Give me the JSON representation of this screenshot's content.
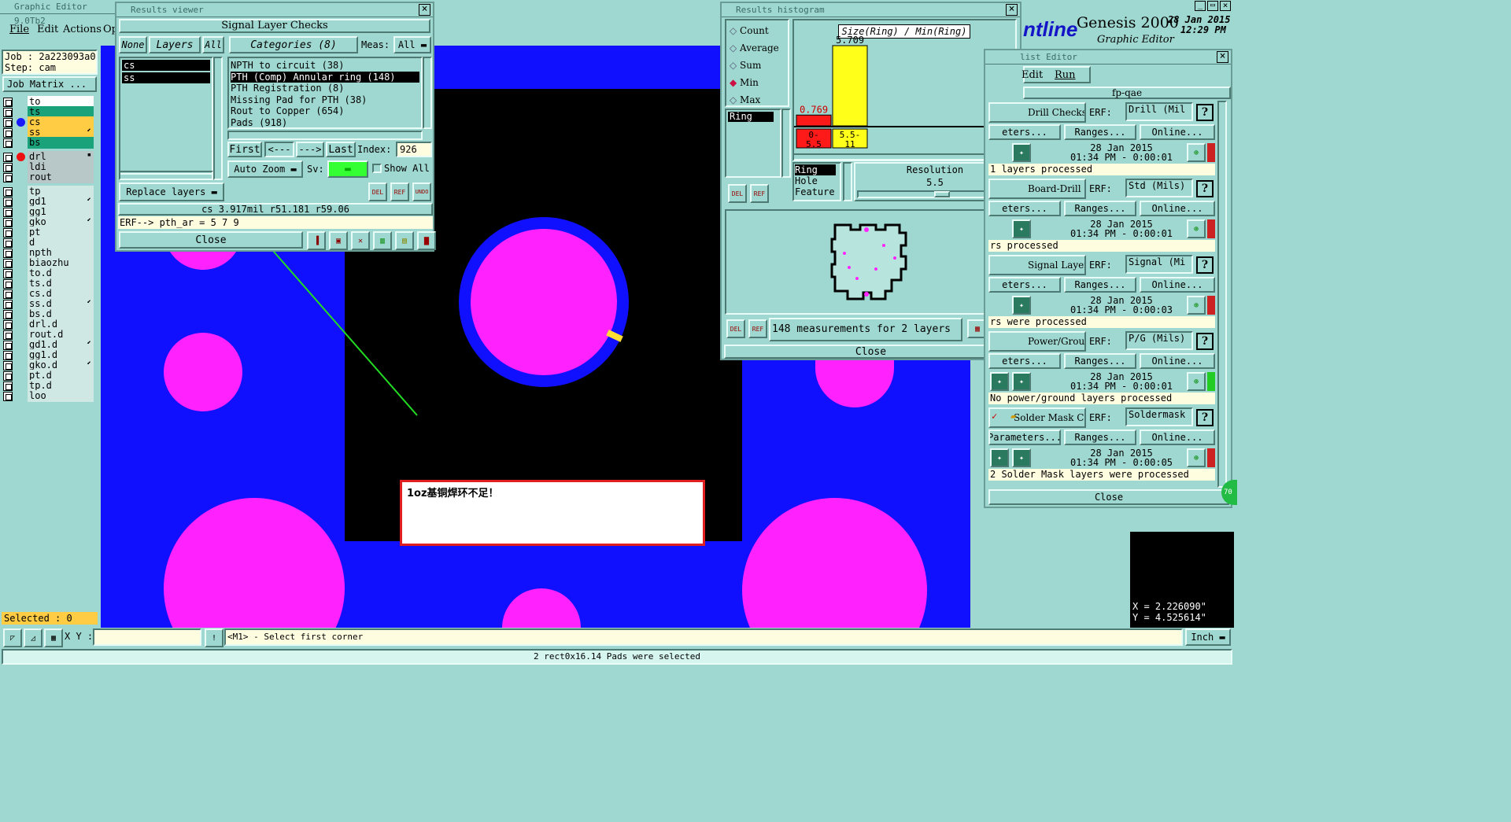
{
  "app": {
    "title": "Graphic Editor 9.0Tb2",
    "menu": [
      "File",
      "Edit",
      "Actions",
      "Op"
    ],
    "job_label": "Job : 2a223093a0",
    "step_label": "Step: cam",
    "job_matrix": "Job Matrix ..."
  },
  "layers": [
    {
      "name": "to",
      "color": "#ffffff",
      "mark": ""
    },
    {
      "name": "ts",
      "color": "#1aa37a",
      "mark": ""
    },
    {
      "name": "cs",
      "color": "#ffcc44",
      "mark": "blue"
    },
    {
      "name": "ss",
      "color": "#ffcc44",
      "mark": "",
      "flag": "⬋"
    },
    {
      "name": "bs",
      "color": "#1aa37a",
      "mark": ""
    },
    {
      "name": "drl",
      "color": "#b8c8c8",
      "mark": "red",
      "flag": "▪"
    },
    {
      "name": "ldi",
      "color": "#b8c8c8",
      "mark": ""
    },
    {
      "name": "rout",
      "color": "#b8c8c8",
      "mark": ""
    },
    {
      "name": "tp",
      "color": "#cfe8e4",
      "mark": ""
    },
    {
      "name": "gd1",
      "color": "#cfe8e4",
      "mark": "",
      "flag": "⬋"
    },
    {
      "name": "gg1",
      "color": "#cfe8e4",
      "mark": ""
    },
    {
      "name": "gko",
      "color": "#cfe8e4",
      "mark": "",
      "flag": "⬋"
    },
    {
      "name": "pt",
      "color": "#cfe8e4",
      "mark": ""
    },
    {
      "name": "d",
      "color": "#cfe8e4",
      "mark": ""
    },
    {
      "name": "npth",
      "color": "#cfe8e4",
      "mark": ""
    },
    {
      "name": "biaozhu",
      "color": "#cfe8e4",
      "mark": ""
    },
    {
      "name": "to.d",
      "color": "#cfe8e4",
      "mark": ""
    },
    {
      "name": "ts.d",
      "color": "#cfe8e4",
      "mark": ""
    },
    {
      "name": "cs.d",
      "color": "#cfe8e4",
      "mark": ""
    },
    {
      "name": "ss.d",
      "color": "#cfe8e4",
      "mark": "",
      "flag": "⬋"
    },
    {
      "name": "bs.d",
      "color": "#cfe8e4",
      "mark": ""
    },
    {
      "name": "drl.d",
      "color": "#cfe8e4",
      "mark": ""
    },
    {
      "name": "rout.d",
      "color": "#cfe8e4",
      "mark": ""
    },
    {
      "name": "gd1.d",
      "color": "#cfe8e4",
      "mark": "",
      "flag": "⬋"
    },
    {
      "name": "gg1.d",
      "color": "#cfe8e4",
      "mark": ""
    },
    {
      "name": "gko.d",
      "color": "#cfe8e4",
      "mark": "",
      "flag": "⬋"
    },
    {
      "name": "pt.d",
      "color": "#cfe8e4",
      "mark": ""
    },
    {
      "name": "tp.d",
      "color": "#cfe8e4",
      "mark": ""
    },
    {
      "name": "loo",
      "color": "#cfe8e4",
      "mark": ""
    }
  ],
  "selected": "Selected : 0",
  "bottom": {
    "xy_label": "X Y :",
    "hint": "<M1> - Select first corner",
    "units": "Inch",
    "status": "2 rect0x16.14 Pads were selected"
  },
  "coords": {
    "x": "X = 2.226090\"",
    "y": "Y = 4.525614\""
  },
  "results_viewer": {
    "title": "Results viewer",
    "header": "Signal Layer Checks",
    "none": "None",
    "layers": "Layers",
    "all": "All",
    "categories": "Categories (8)",
    "meas_label": "Meas:",
    "meas_value": "All",
    "layer_list": [
      "cs",
      "ss"
    ],
    "category_list": [
      "NPTH to circuit (38)",
      "PTH (Comp) Annular ring (148)",
      "PTH Registration (8)",
      "Missing Pad for PTH (38)",
      "Rout to Copper (654)",
      "Pads (918)"
    ],
    "first": "First",
    "prev": "<---",
    "next": "--->",
    "last": "Last",
    "index_label": "Index:",
    "index_value": "926",
    "auto_zoom": "Auto Zoom",
    "sv": "Sv:",
    "show_all": "Show All",
    "replace_layers": "Replace layers",
    "info": "cs 3.917mil   r51.181   r59.06",
    "erf": "ERF--> pth_ar = 5 7 9",
    "close": "Close",
    "icons": [
      "DEL",
      "REF",
      "UNDO"
    ]
  },
  "histogram": {
    "title": "Results histogram",
    "modes": [
      "Count",
      "Average",
      "Sum",
      "Min",
      "Max"
    ],
    "selected_mode": "Min",
    "ring_label": "Ring",
    "chart_title": "Size(Ring) / Min(Ring)",
    "types": [
      "Ring",
      "Hole",
      "Feature"
    ],
    "resolution_label": "Resolution",
    "resolution_value": "5.5",
    "summary": "148 measurements for 2 layers",
    "close": "Close",
    "icons": [
      "DEL",
      "REF"
    ]
  },
  "chart_data": {
    "type": "bar",
    "title": "Size(Ring) / Min(Ring)",
    "categories": [
      "0-5.5",
      "5.5-11"
    ],
    "values": [
      0.769,
      5.709
    ],
    "colors": [
      "#ff1a1a",
      "#ffff1a"
    ]
  },
  "brand": {
    "logo": "ntline",
    "product": "Genesis 2000",
    "subtitle": "Graphic Editor",
    "date": "28 Jan 2015",
    "time": "12:29 PM"
  },
  "checklist": {
    "title": "list Editor",
    "menu": [
      "Edit",
      "Run"
    ],
    "name": "fp-qae",
    "close": "Close",
    "checks": [
      {
        "name": "Drill Checks",
        "erf": "Drill (Mil",
        "time": "28 Jan 2015",
        "time2": "01:34 PM - 0:00:01",
        "msg": "1 layers processed",
        "status": "#cc2222",
        "help": "?"
      },
      {
        "name": "Board-Drill Che",
        "erf": "Std (Mils)",
        "time": "28 Jan 2015",
        "time2": "01:34 PM - 0:00:01",
        "msg": "rs processed",
        "status": "#cc2222",
        "help": "?"
      },
      {
        "name": "Signal Layer Ch",
        "erf": "Signal (Mi",
        "time": "28 Jan 2015",
        "time2": "01:34 PM - 0:00:03",
        "msg": "rs were processed",
        "status": "#cc2222",
        "help": "?"
      },
      {
        "name": "Power/Ground C",
        "erf": "P/G (Mils)",
        "time": "28 Jan 2015",
        "time2": "01:34 PM - 0:00:01",
        "msg": "No power/ground layers processed",
        "status": "#22cc22",
        "help": "?"
      },
      {
        "name": "Solder Mask Ch",
        "erf": "Soldermask",
        "time": "28 Jan 2015",
        "time2": "01:34 PM - 0:00:05",
        "msg": "2 Solder Mask layers were processed",
        "status": "#cc2222",
        "help": "?"
      }
    ],
    "params": "Parameters...",
    "params_cut": "eters...",
    "ranges": "Ranges...",
    "online": "Online...",
    "erf_label": "ERF:"
  },
  "annotation": "1oz基铜焊环不足！"
}
